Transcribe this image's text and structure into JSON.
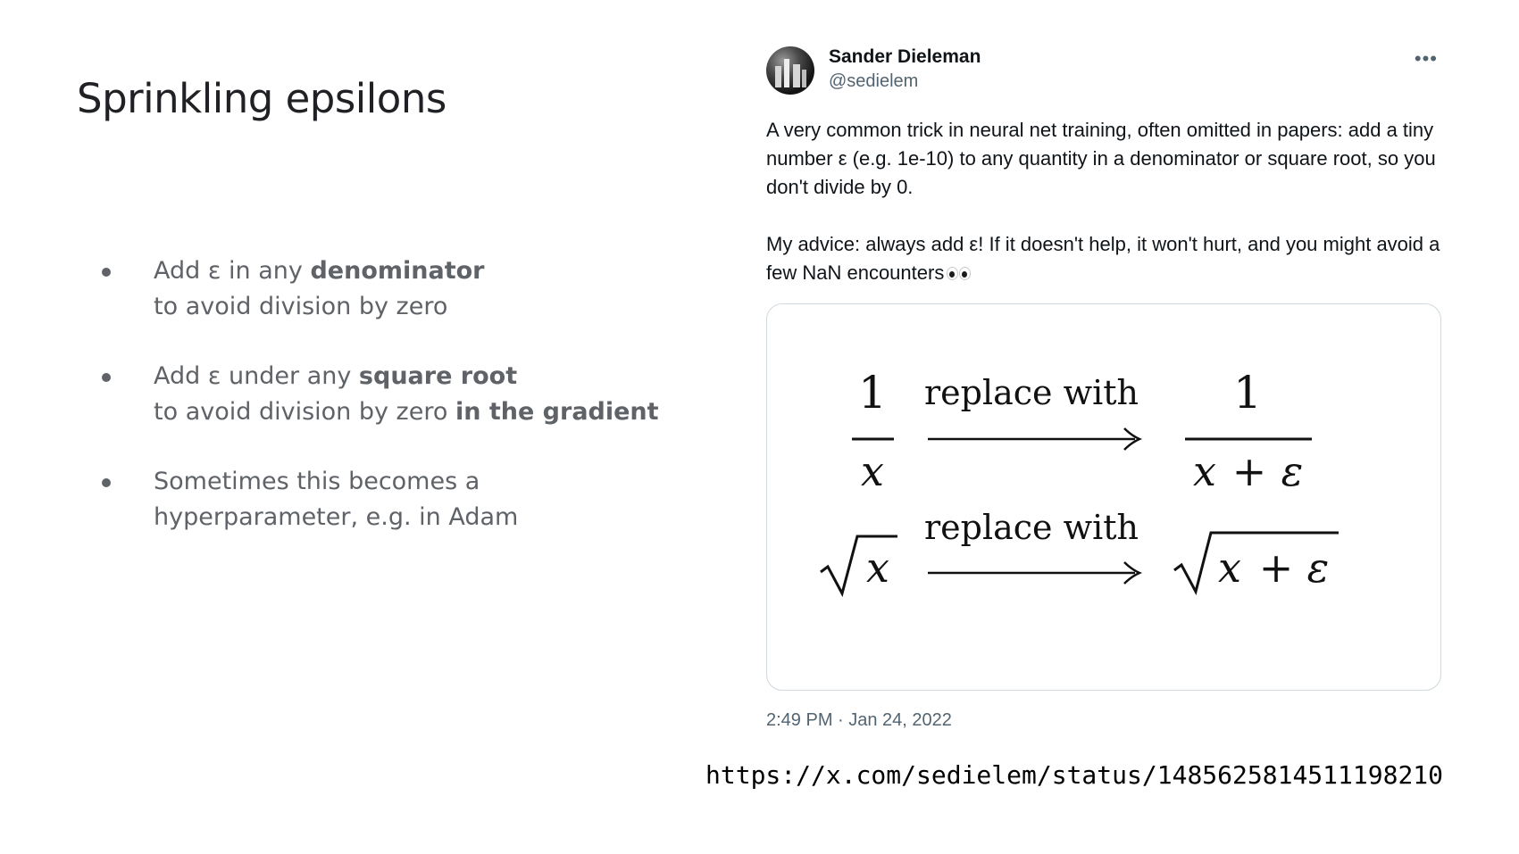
{
  "slide": {
    "title": "Sprinkling epsilons",
    "bullets": [
      {
        "line1_a": "Add ε in any ",
        "line1_b": "denominator",
        "line2_a": "to avoid division by zero",
        "line2_b": ""
      },
      {
        "line1_a": "Add ε under any ",
        "line1_b": "square root",
        "line2_a": "to avoid division by zero ",
        "line2_b": "in the gradient"
      },
      {
        "line1_a": "Sometimes this becomes a",
        "line1_b": "",
        "line2_a": "hyperparameter, e.g. in Adam",
        "line2_b": ""
      }
    ]
  },
  "tweet": {
    "author_name": "Sander Dieleman",
    "handle": "@sedielem",
    "more_icon": "more-icon",
    "paragraph1": "A very common trick in neural net training, often omitted in papers: add a tiny number ε (e.g. 1e-10) to any quantity in a denominator or square root, so you don't divide by 0.",
    "paragraph2": "My advice: always add ε! If it doesn't help, it won't hurt, and you might avoid a few NaN encounters",
    "emoji": "eyes-icon",
    "timestamp": "2:49 PM · Jan 24, 2022",
    "image": {
      "row1": {
        "left_num": "1",
        "left_den": "x",
        "arrow_label": "replace with",
        "right_num": "1",
        "right_den_x": "x",
        "right_den_op": "+",
        "right_den_eps": "ε"
      },
      "row2": {
        "left_arg": "x",
        "arrow_label": "replace with",
        "right_x": "x",
        "right_op": "+",
        "right_eps": "ε"
      }
    }
  },
  "url": "https://x.com/sedielem/status/1485625814511198210"
}
